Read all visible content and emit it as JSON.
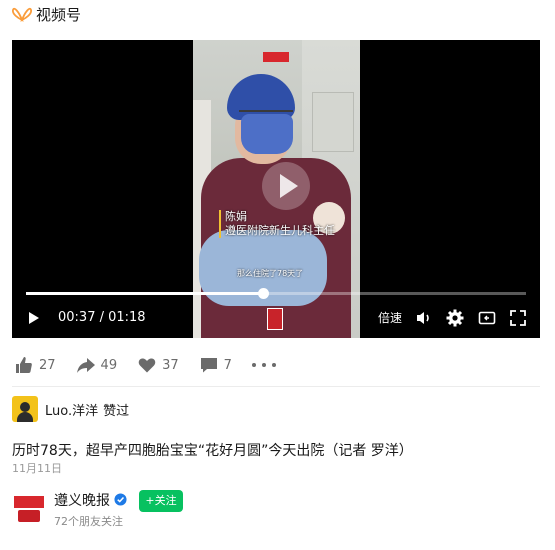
{
  "header": {
    "title": "视频号",
    "icon": "channels-butterfly-icon",
    "icon_color": "#fa9d3b"
  },
  "video": {
    "caption_name": "陈娟",
    "caption_title": "遵医附院新生儿科主任",
    "subtitle": "那么住院了78天了",
    "current_time": "00:37",
    "duration": "01:18",
    "time_display": "00:37 / 01:18",
    "progress": 0.474,
    "speed_label": "倍速",
    "controls": [
      "play-icon",
      "volume-icon",
      "settings-icon",
      "picture-in-picture-icon",
      "fullscreen-icon"
    ]
  },
  "actions": {
    "like": {
      "icon": "thumbs-up-icon",
      "count": "27"
    },
    "share": {
      "icon": "share-arrow-icon",
      "count": "49"
    },
    "heart": {
      "icon": "heart-icon",
      "count": "37"
    },
    "comment": {
      "icon": "comment-icon",
      "count": "7"
    },
    "more": {
      "icon": "more-icon"
    }
  },
  "liker": {
    "name": "Luo.洋洋",
    "status": "赞过"
  },
  "post": {
    "text": "历时78天，超早产四胞胎宝宝“花好月圆”今天出院（记者 罗洋）",
    "date": "11月11日"
  },
  "account": {
    "name": "遵义晚报",
    "followers": "72个朋友关注",
    "follow_label": "+关注",
    "verified_color": "#1e7ae6",
    "follow_color": "#07c160"
  }
}
